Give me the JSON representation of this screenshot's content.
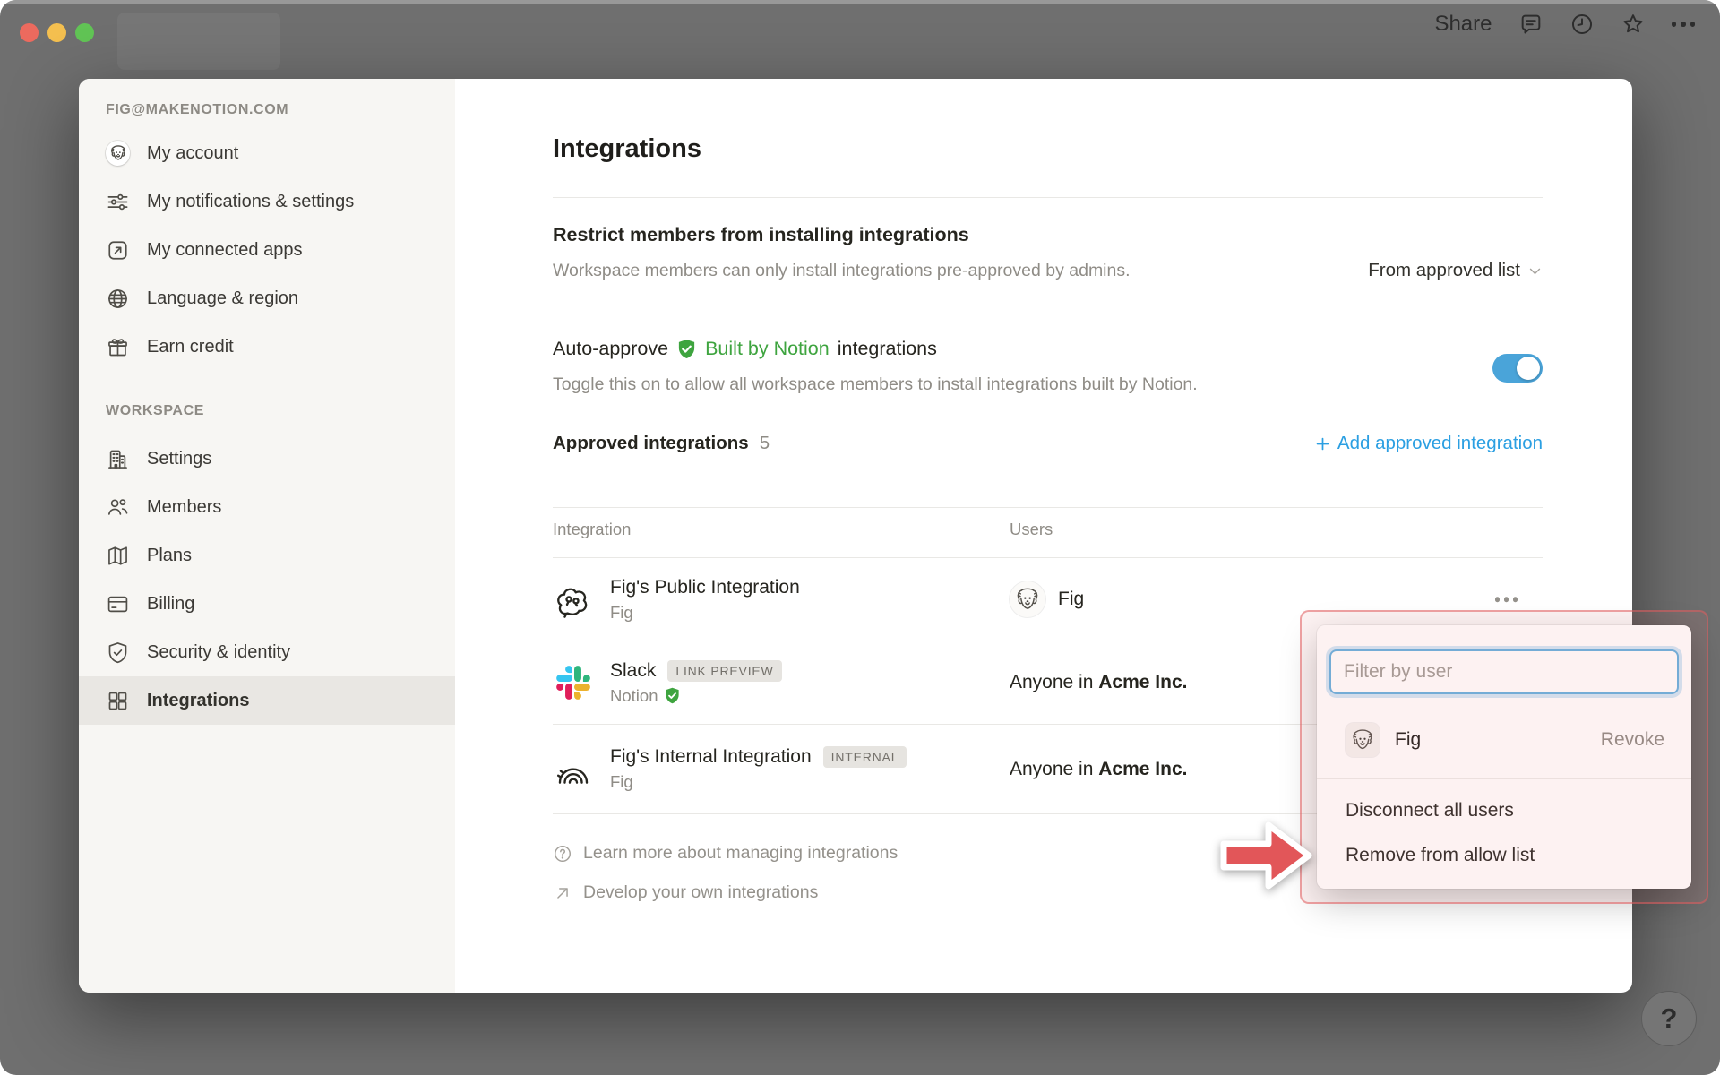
{
  "titlebar": {
    "share_label": "Share"
  },
  "sidebar": {
    "email": "FIG@MAKENOTION.COM",
    "account_items": [
      {
        "label": "My account"
      },
      {
        "label": "My notifications & settings"
      },
      {
        "label": "My connected apps"
      },
      {
        "label": "Language & region"
      },
      {
        "label": "Earn credit"
      }
    ],
    "workspace_label": "WORKSPACE",
    "workspace_items": [
      {
        "label": "Settings"
      },
      {
        "label": "Members"
      },
      {
        "label": "Plans"
      },
      {
        "label": "Billing"
      },
      {
        "label": "Security & identity"
      },
      {
        "label": "Integrations",
        "selected": true
      }
    ]
  },
  "main": {
    "title": "Integrations",
    "restrict": {
      "title": "Restrict members from installing integrations",
      "description": "Workspace members can only install integrations pre-approved by admins.",
      "dropdown_value": "From approved list"
    },
    "auto_approve": {
      "prefix": "Auto-approve",
      "badge_label": "Built by Notion",
      "suffix": "integrations",
      "description": "Toggle this on to allow all workspace members to install integrations built by Notion.",
      "toggle_state": "on"
    },
    "approved": {
      "title": "Approved integrations",
      "count": "5",
      "add_label": "Add approved integration"
    },
    "table": {
      "col_integration": "Integration",
      "col_users": "Users",
      "rows": [
        {
          "name": "Fig's Public Integration",
          "subtitle": "Fig",
          "user": "Fig"
        },
        {
          "name": "Slack",
          "badge": "LINK PREVIEW",
          "subtitle": "Notion",
          "users_prefix": "Anyone in",
          "users_org": "Acme Inc."
        },
        {
          "name": "Fig's Internal Integration",
          "badge": "INTERNAL",
          "subtitle": "Fig",
          "users_prefix": "Anyone in",
          "users_org": "Acme Inc."
        }
      ]
    },
    "footer": {
      "learn_label": "Learn more about managing integrations",
      "develop_label": "Develop your own integrations"
    }
  },
  "popup": {
    "filter_placeholder": "Filter by user",
    "user_name": "Fig",
    "revoke_label": "Revoke",
    "item_disconnect": "Disconnect all users",
    "item_remove": "Remove from allow list"
  },
  "help": {
    "label": "?"
  },
  "colors": {
    "accent_blue": "#2b9fe2",
    "toggle_blue": "#4aa4d9",
    "notion_green": "#3ea43f",
    "annotation_red": "#e25659"
  }
}
